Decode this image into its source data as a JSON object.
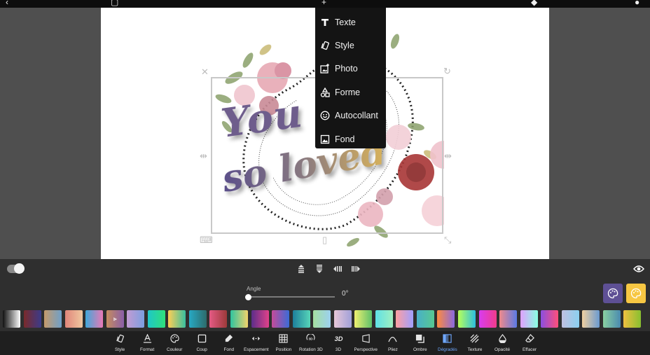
{
  "add_menu": {
    "items": [
      {
        "label": "Texte"
      },
      {
        "label": "Style"
      },
      {
        "label": "Photo"
      },
      {
        "label": "Forme"
      },
      {
        "label": "Autocollant"
      },
      {
        "label": "Fond"
      }
    ]
  },
  "canvas": {
    "text_line1": "You",
    "text_line2": "so loved"
  },
  "controls": {
    "angle_label": "Angle",
    "angle_value": "0°",
    "angle_fraction": 0
  },
  "gradients": [
    [
      "#111111",
      "#ffffff"
    ],
    [
      "#7a2a2a",
      "#3b3b8a"
    ],
    [
      "#c59a6b",
      "#6fa0c9"
    ],
    [
      "#e0857a",
      "#f0c8a0"
    ],
    [
      "#3fa8d9",
      "#e979b6"
    ],
    [
      "#c58c5e",
      "#8a5ea8"
    ],
    [
      "#c39bd3",
      "#7b9fe0"
    ],
    [
      "#1ec7c7",
      "#30e07a"
    ],
    [
      "#ffce54",
      "#38c0a0"
    ],
    [
      "#27a9c4",
      "#2d6b6b"
    ],
    [
      "#e45a84",
      "#9c3a3a"
    ],
    [
      "#2ec4a0",
      "#f2d36b"
    ],
    [
      "#5b2e8a",
      "#e0418a"
    ],
    [
      "#c54b9a",
      "#3b6bd6"
    ],
    [
      "#1d7f9c",
      "#57d5b8"
    ],
    [
      "#a5e0a0",
      "#9cd0f0"
    ],
    [
      "#e8c7d8",
      "#a0a0d8"
    ],
    [
      "#f0f070",
      "#5dc06a"
    ],
    [
      "#5ee0e6",
      "#a0f0c0"
    ],
    [
      "#ff9f9f",
      "#9f9fff"
    ],
    [
      "#48b0c8",
      "#58c890"
    ],
    [
      "#ff8a3d",
      "#8a6ae0"
    ],
    [
      "#b8ff58",
      "#2cbfe0"
    ],
    [
      "#d83cf0",
      "#f03c8a"
    ],
    [
      "#f08a8a",
      "#5a7ae6"
    ],
    [
      "#e0a0ff",
      "#88ffe0"
    ],
    [
      "#8a4fe0",
      "#ff4f7a"
    ],
    [
      "#c0c0e0",
      "#8ad0f0"
    ],
    [
      "#f0d0a0",
      "#6a9ad0"
    ],
    [
      "#8ad0a0",
      "#4a8ab0"
    ],
    [
      "#f0c040",
      "#88c030"
    ]
  ],
  "toolbar": {
    "items": [
      {
        "label": "Style",
        "icon": "style-icon"
      },
      {
        "label": "Format",
        "icon": "format-icon"
      },
      {
        "label": "Couleur",
        "icon": "palette-icon"
      },
      {
        "label": "Coup",
        "icon": "stroke-icon"
      },
      {
        "label": "Fond",
        "icon": "fill-icon"
      },
      {
        "label": "Espacement",
        "icon": "spacing-icon"
      },
      {
        "label": "Position",
        "icon": "grid-icon"
      },
      {
        "label": "Rotation 3D",
        "icon": "rotation-3d-icon"
      },
      {
        "label": "3D",
        "icon": "3d-icon"
      },
      {
        "label": "Perspective",
        "icon": "perspective-icon"
      },
      {
        "label": "Pliez",
        "icon": "bend-icon"
      },
      {
        "label": "Ombre",
        "icon": "shadow-icon"
      },
      {
        "label": "Dégradés",
        "icon": "gradient-icon"
      },
      {
        "label": "Texture",
        "icon": "texture-icon"
      },
      {
        "label": "Opacité",
        "icon": "opacity-icon"
      },
      {
        "label": "Effacer",
        "icon": "eraser-icon"
      }
    ],
    "active": "Dégradés"
  },
  "colors": {
    "accent": "#6fa8ff",
    "palette_purple": "#5e5095",
    "palette_yellow": "#f7c743"
  }
}
